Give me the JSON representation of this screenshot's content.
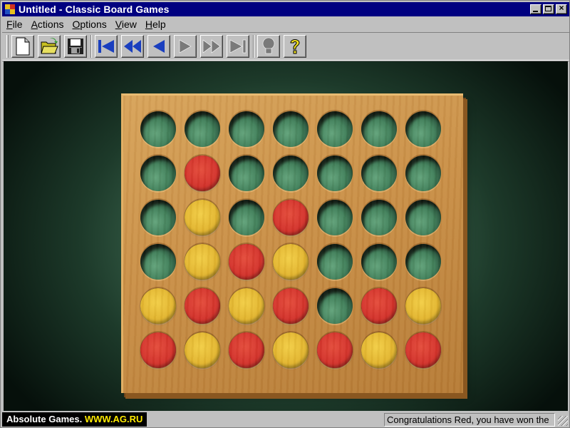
{
  "window": {
    "title": "Untitled - Classic Board Games",
    "controls": [
      "minimize",
      "maximize",
      "close"
    ],
    "close_glyph": "×"
  },
  "menu": {
    "items": [
      {
        "label": "File",
        "underline": "F",
        "rest": "ile"
      },
      {
        "label": "Actions",
        "underline": "A",
        "rest": "ctions"
      },
      {
        "label": "Options",
        "underline": "O",
        "rest": "ptions"
      },
      {
        "label": "View",
        "underline": "V",
        "rest": "iew"
      },
      {
        "label": "Help",
        "underline": "H",
        "rest": "elp"
      }
    ]
  },
  "toolbar": {
    "buttons": [
      {
        "name": "new-game",
        "icon": "new-document-icon",
        "enabled": true
      },
      {
        "name": "open-game",
        "icon": "open-folder-icon",
        "enabled": true
      },
      {
        "name": "save-game",
        "icon": "floppy-disk-icon",
        "enabled": true
      },
      {
        "name": "first-move",
        "icon": "skip-to-start-icon",
        "enabled": true
      },
      {
        "name": "rewind",
        "icon": "rewind-icon",
        "enabled": true
      },
      {
        "name": "previous-move",
        "icon": "step-back-icon",
        "enabled": true
      },
      {
        "name": "next-move",
        "icon": "step-forward-icon",
        "enabled": false
      },
      {
        "name": "fast-forward",
        "icon": "fast-forward-icon",
        "enabled": false
      },
      {
        "name": "last-move",
        "icon": "skip-to-end-icon",
        "enabled": false
      },
      {
        "name": "hint",
        "icon": "lightbulb-icon",
        "enabled": false
      },
      {
        "name": "help",
        "icon": "question-mark-icon",
        "enabled": true
      }
    ],
    "colors": {
      "enabled_arrow": "#1a3fbf",
      "disabled": "#7a7a7a",
      "help": "#f0e020"
    }
  },
  "game": {
    "name": "Connect Four",
    "rows": 6,
    "columns": 7,
    "board": [
      [
        "",
        "",
        "",
        "",
        "",
        "",
        ""
      ],
      [
        "",
        "R",
        "",
        "",
        "",
        "",
        ""
      ],
      [
        "",
        "Y",
        "",
        "R",
        "",
        "",
        ""
      ],
      [
        "",
        "Y",
        "R",
        "Y",
        "",
        "",
        ""
      ],
      [
        "Y",
        "R",
        "Y",
        "R",
        "",
        "R",
        "Y"
      ],
      [
        "R",
        "Y",
        "R",
        "Y",
        "R",
        "Y",
        "R"
      ]
    ],
    "colors": {
      "red": "#d3302b",
      "yellow": "#e3b62f",
      "board_wood": "#c98f47"
    }
  },
  "statusbar": {
    "brand_name": "Absolute Games.",
    "brand_url": "WWW.AG.RU",
    "message": "Congratulations Red, you have won the"
  }
}
